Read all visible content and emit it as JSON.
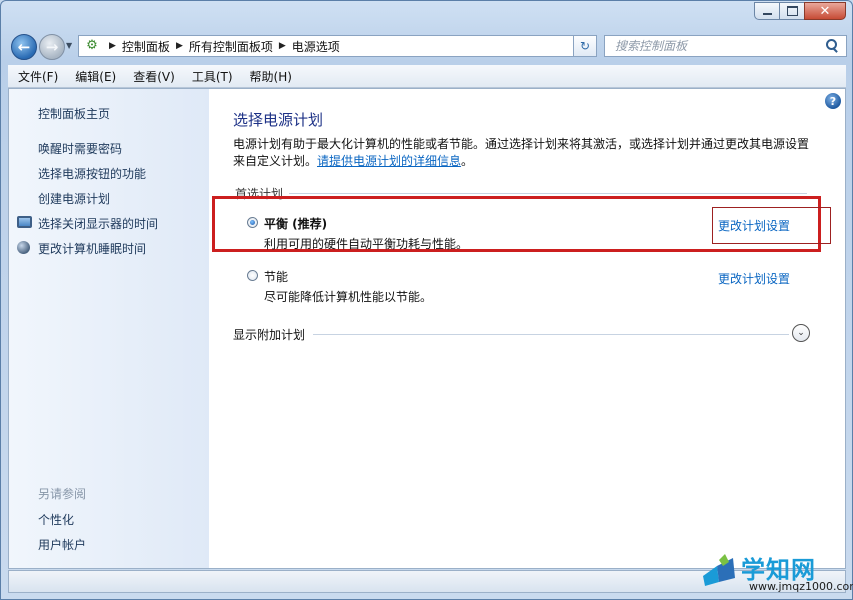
{
  "window": {
    "caption": {
      "min_icon": "minimize-icon",
      "max_icon": "maximize-icon",
      "close_icon": "close-icon",
      "close_glyph": "✕"
    }
  },
  "navbar": {
    "back_icon": "back-arrow-icon",
    "forward_icon": "forward-arrow-icon",
    "breadcrumbs": [
      "控制面板",
      "所有控制面板项",
      "电源选项"
    ],
    "search_placeholder": "搜索控制面板"
  },
  "menubar": {
    "items": [
      "文件(F)",
      "编辑(E)",
      "查看(V)",
      "工具(T)",
      "帮助(H)"
    ]
  },
  "sidebar": {
    "home": "控制面板主页",
    "links": [
      "唤醒时需要密码",
      "选择电源按钮的功能",
      "创建电源计划",
      "选择关闭显示器的时间",
      "更改计算机睡眠时间"
    ],
    "see_also_header": "另请参阅",
    "see_also": [
      "个性化",
      "用户帐户"
    ]
  },
  "main": {
    "title": "选择电源计划",
    "intro_text": "电源计划有助于最大化计算机的性能或者节能。通过选择计划来将其激活，或选择计划并通过更改其电源设置来自定义计划。",
    "intro_link": "请提供电源计划的详细信息",
    "intro_end": "。",
    "preferred_header": "首选计划",
    "plans": [
      {
        "name": "平衡 (推荐)",
        "description": "利用可用的硬件自动平衡功耗与性能。",
        "link": "更改计划设置",
        "selected": true
      },
      {
        "name": "节能",
        "description": "尽可能降低计算机性能以节能。",
        "link": "更改计划设置",
        "selected": false
      }
    ],
    "more_plans": "显示附加计划",
    "help_glyph": "?"
  },
  "watermark": {
    "text": "学知网",
    "url": "www.jmqz1000.com"
  },
  "colors": {
    "highlight": "#cc1f1f",
    "link": "#0a66c2",
    "title": "#1e3287"
  }
}
